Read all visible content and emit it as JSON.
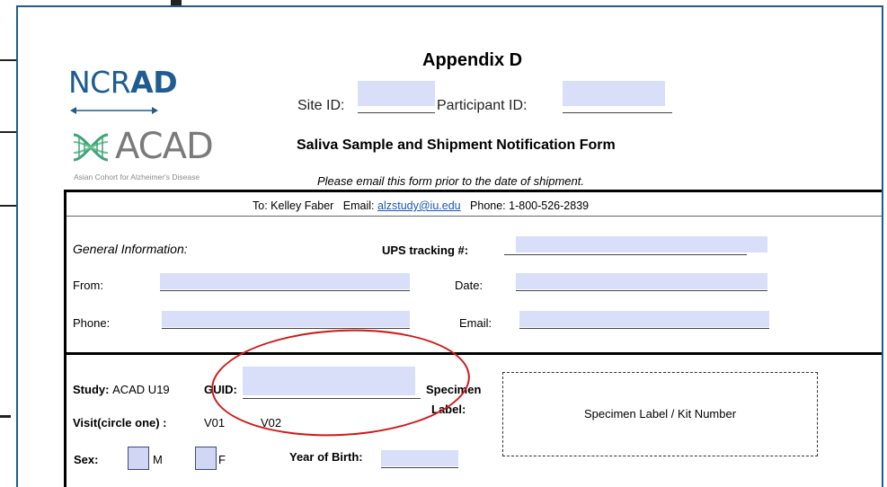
{
  "header": {
    "appendix": "Appendix D",
    "site_id_label": "Site ID:",
    "participant_id_label": "Participant ID:",
    "form_title": "Saliva Sample and Shipment Notification Form",
    "instruction": "Please email this form prior to the date of shipment."
  },
  "logos": {
    "ncrad_prefix": "NCR",
    "ncrad_bold": "AD",
    "acad": "ACAD",
    "acad_subtitle": "Asian Cohort for Alzheimer's Disease"
  },
  "contact": {
    "to_label": "To:",
    "to_name": "Kelley Faber",
    "email_label": "Email:",
    "email": "alzstudy@iu.edu",
    "phone_label": "Phone:",
    "phone": "1-800-526-2839"
  },
  "general": {
    "heading": "General Information:",
    "ups_label": "UPS tracking #:",
    "from_label": "From:",
    "date_label": "Date:",
    "phone_label": "Phone:",
    "email_label": "Email:"
  },
  "sample": {
    "study_label": "Study:",
    "study_value": "ACAD U19",
    "guid_label": "GUID:",
    "visit_label": "Visit(circle one) :",
    "visit_options": [
      "V01",
      "V02"
    ],
    "sex_label": "Sex:",
    "sex_options": [
      "M",
      "F"
    ],
    "yob_label": "Year of Birth:",
    "specimen_label_line1": "Specimen",
    "specimen_label_line2": "Label:",
    "specimen_box_text": "Specimen Label / Kit Number"
  },
  "colors": {
    "field_fill": "#d9def9",
    "annotation": "#d01818",
    "brand_blue": "#1f5c8f"
  }
}
